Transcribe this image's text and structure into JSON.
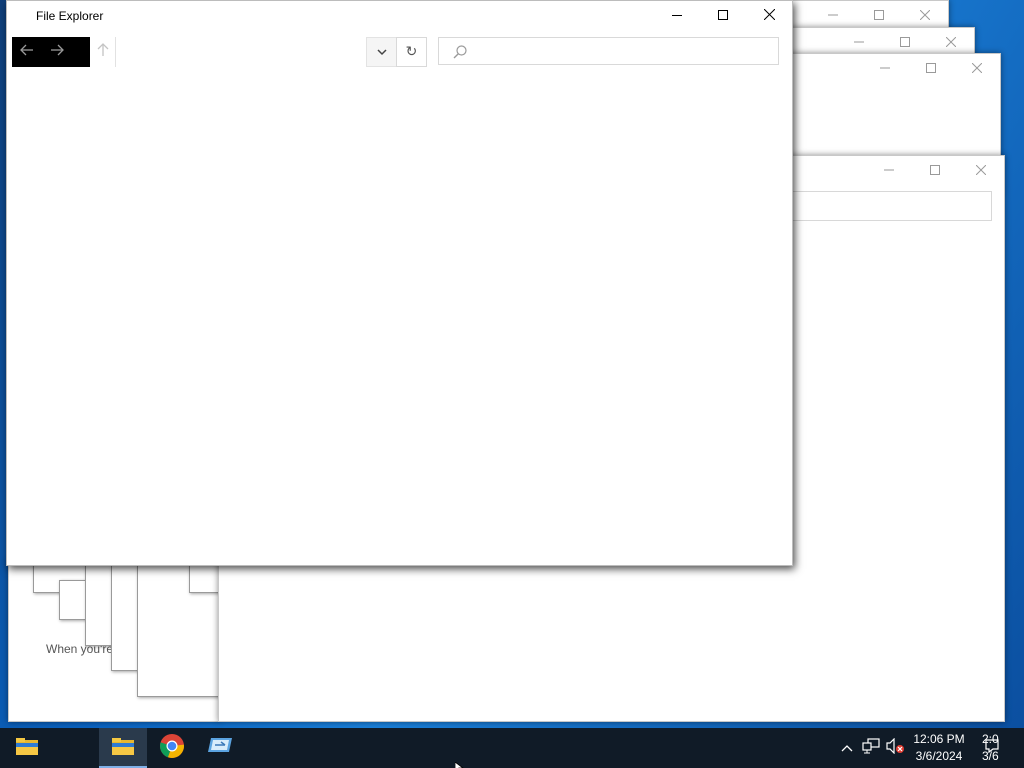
{
  "main_window": {
    "title": "File Explorer",
    "search_placeholder": "",
    "controls": {
      "minimize_icon": "minimize-icon",
      "maximize_icon": "maximize-icon",
      "close_icon": "close-icon"
    },
    "nav": {
      "back_icon": "arrow-left-icon",
      "forward_icon": "arrow-right-icon",
      "up_icon": "arrow-up-icon",
      "dropdown_icon": "chevron-down-icon",
      "refresh_glyph": "↻",
      "search_icon": "search-icon"
    }
  },
  "background_windows": {
    "hint_text": "When you're"
  },
  "taskbar": {
    "apps": [
      {
        "name": "File Explorer",
        "icon": "folder-icon",
        "active": false
      },
      {
        "name": "File Explorer",
        "icon": "folder-icon",
        "active": true
      },
      {
        "name": "Google Chrome",
        "icon": "chrome-icon",
        "active": false
      },
      {
        "name": "Run",
        "icon": "run-icon",
        "active": false
      }
    ],
    "tray": {
      "time": "12:06 PM",
      "date": "3/6/2024",
      "time_secondary": "2:0",
      "date_secondary": "3/6"
    }
  },
  "colors": {
    "desktop": "#0a5fb0",
    "taskbar": "#101b27",
    "active_indicator": "#7fb0e8"
  }
}
